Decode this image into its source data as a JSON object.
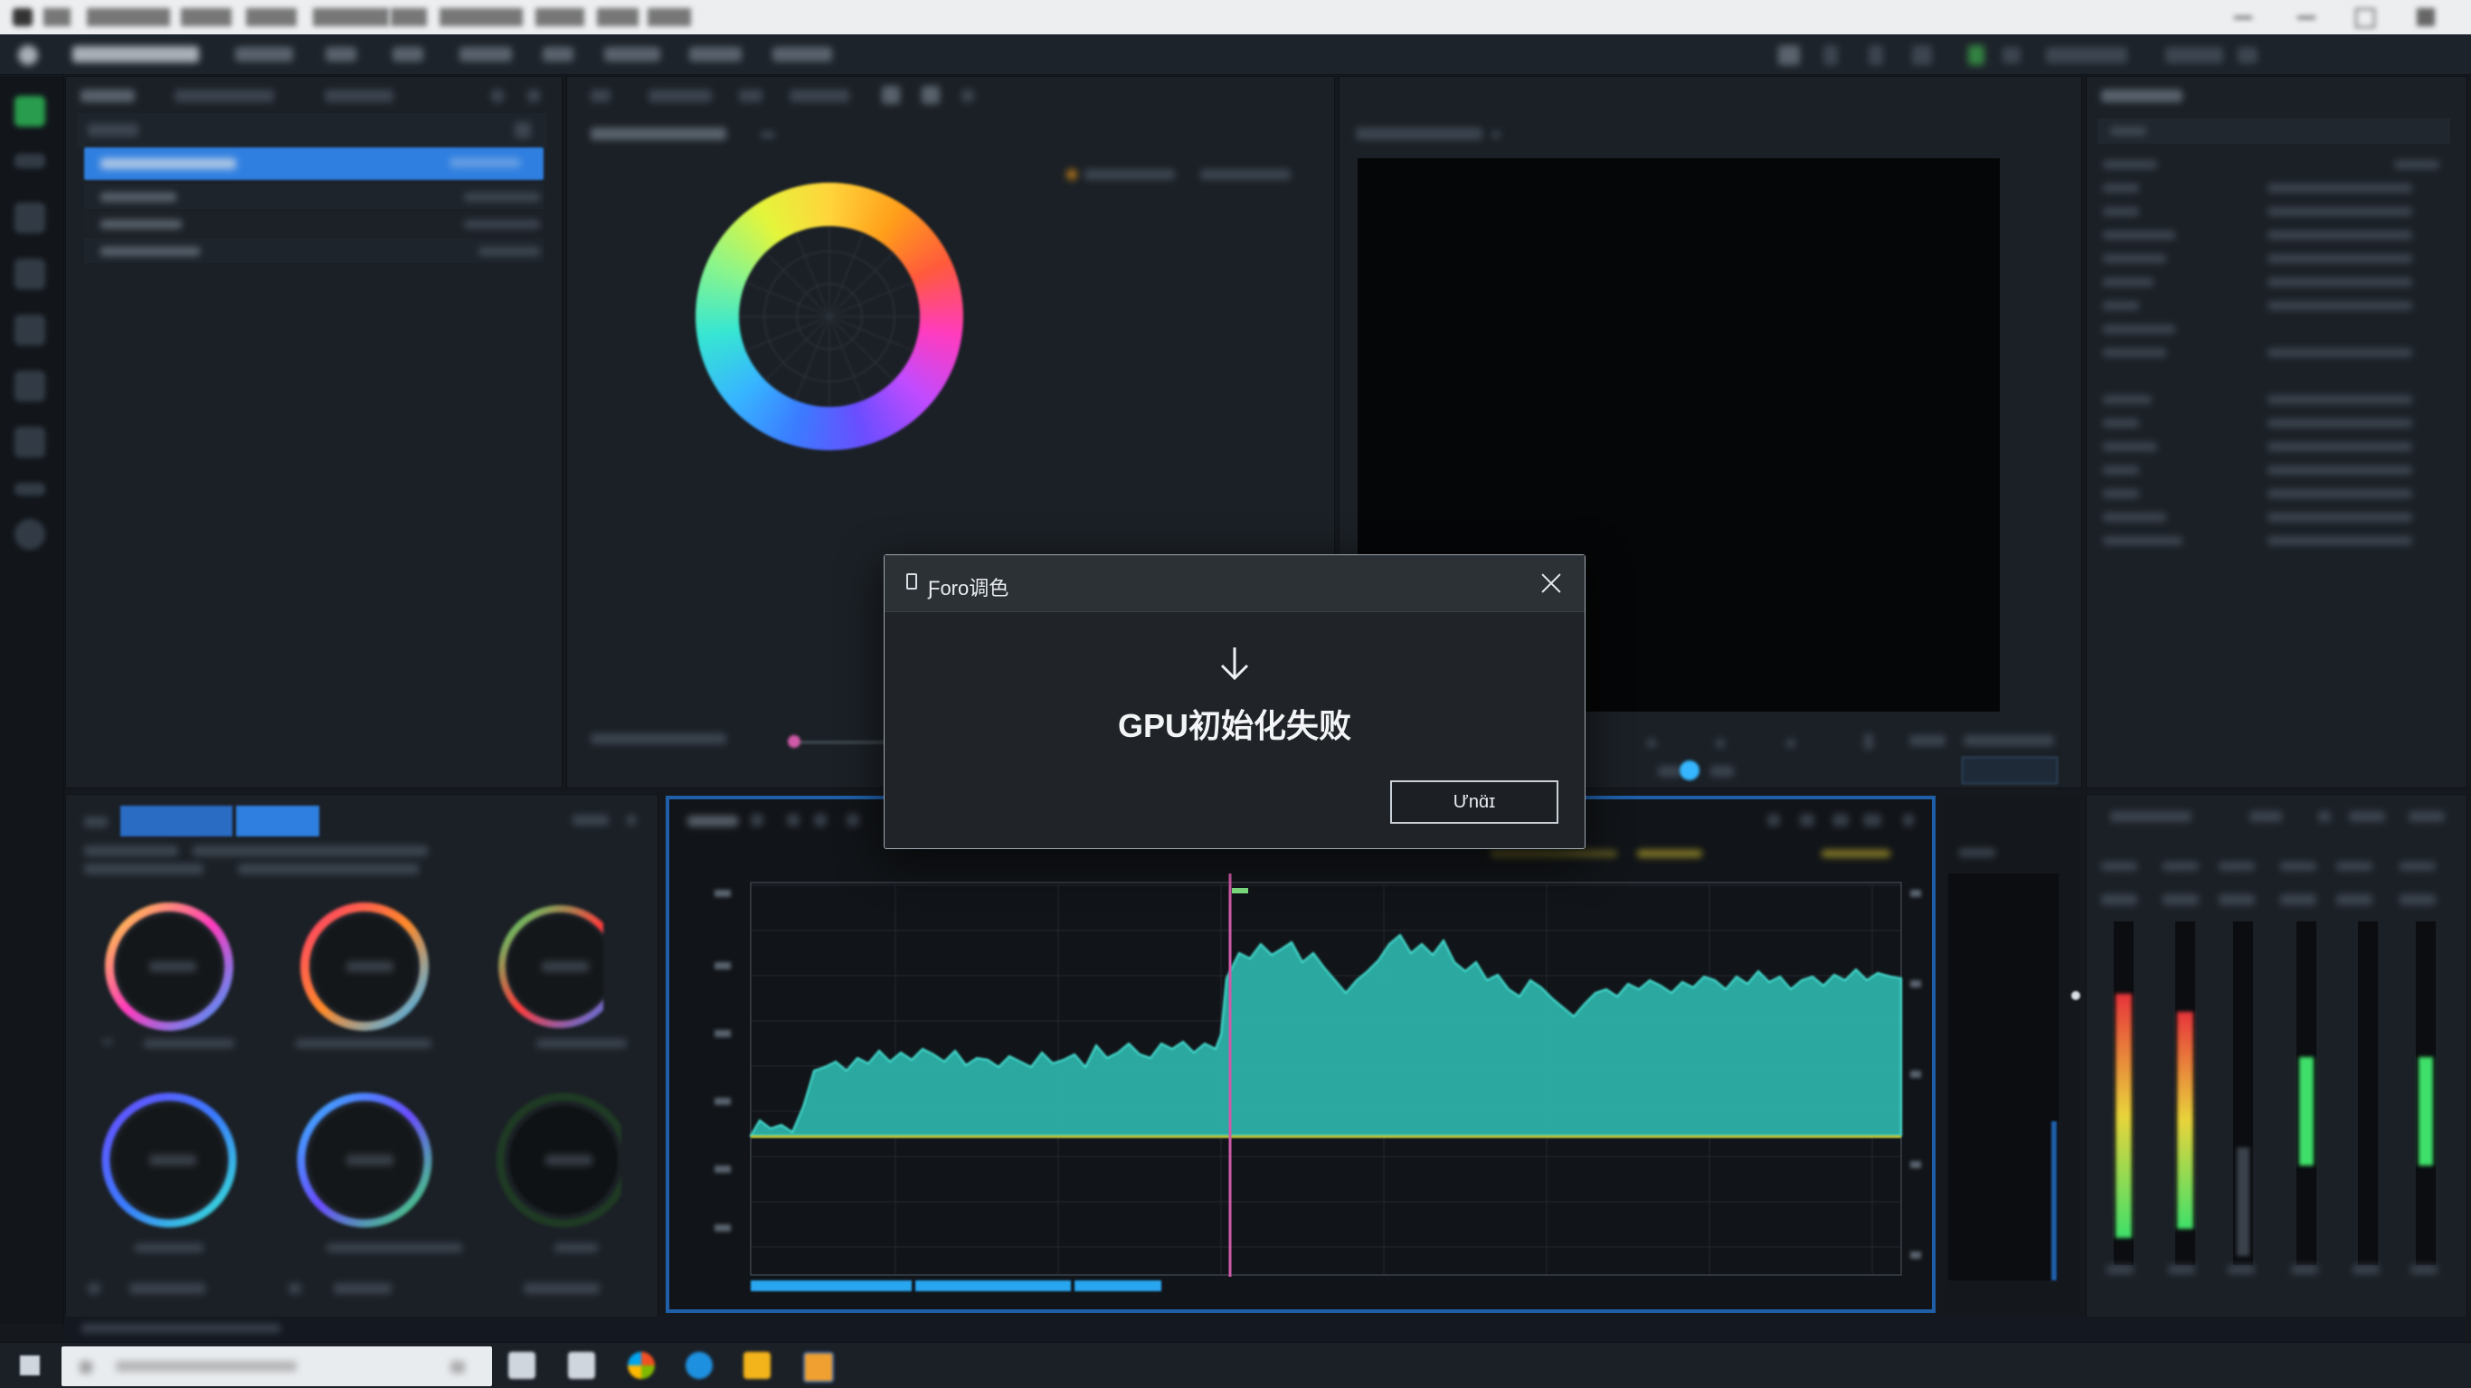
{
  "dialog": {
    "title": "Ƒoro调色",
    "message": "GPU初始化失败",
    "button_label": "Ưnɑ̈ɪ",
    "icon_names": [
      "app-icon",
      "close-icon",
      "download-arrow-icon"
    ]
  },
  "colors": {
    "accent_blue": "#2f7fe0",
    "waveform_cyan": "#35d6c8",
    "playhead": "#d15aa8",
    "meter_green": "#3fe06a",
    "meter_red": "#e8343b",
    "dialog_bg": "#202428"
  }
}
